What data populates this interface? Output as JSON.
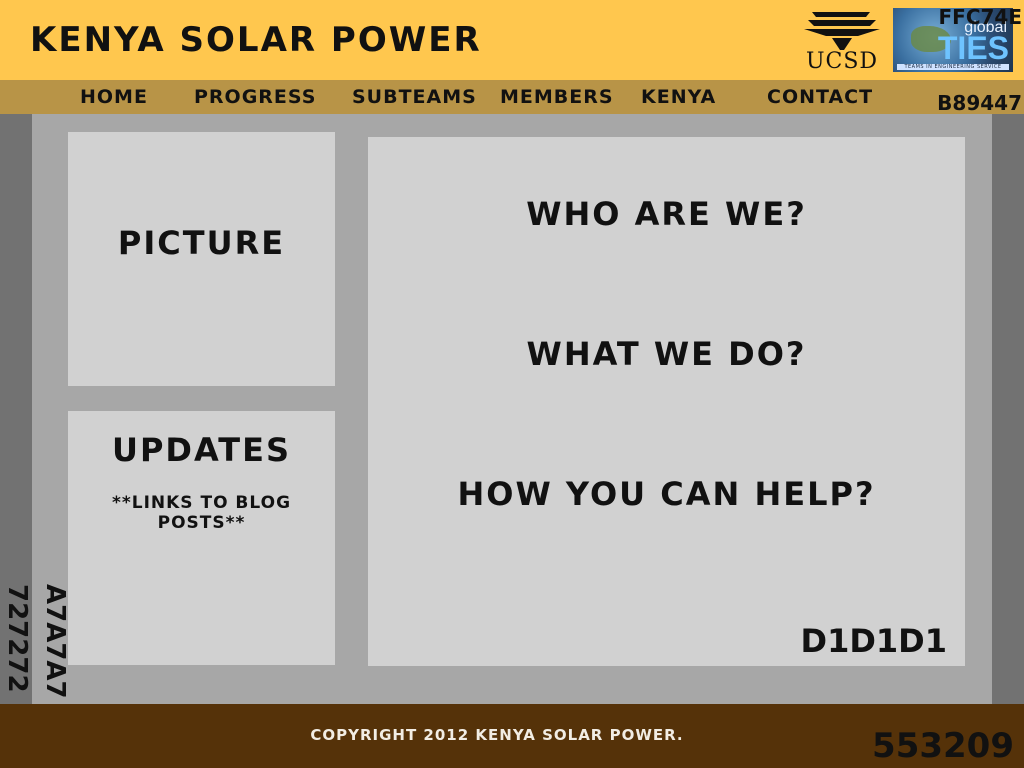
{
  "header": {
    "title": "Kenya Solar Power",
    "color_tag": "FFC74E",
    "background": "#FFC74E",
    "ucsd_logo_text": "UCSD",
    "ties_logo": {
      "global": "global",
      "big": "TIES",
      "tagline": "TEAMS IN ENGINEERING SERVICE"
    }
  },
  "nav": {
    "background": "#B89447",
    "color_tag": "B89447",
    "items": [
      {
        "label": "Home"
      },
      {
        "label": "Progress"
      },
      {
        "label": "Subteams"
      },
      {
        "label": "Members"
      },
      {
        "label": "Kenya"
      },
      {
        "label": "Contact"
      }
    ]
  },
  "side": {
    "outer_color_tag": "727272",
    "inner_color_tag": "A7A7A7",
    "outer_background": "#727272",
    "inner_background": "#A7A7A7"
  },
  "picture_panel": {
    "heading": "Picture"
  },
  "updates_panel": {
    "heading": "Updates",
    "subtext": "**Links to blog posts**"
  },
  "main_panel": {
    "background": "#D1D1D1",
    "color_tag": "D1D1D1",
    "questions": [
      "Who are we?",
      "What we do?",
      "How you can help?"
    ]
  },
  "footer": {
    "background": "#553209",
    "copyright": "Copyright 2012 Kenya Solar Power.",
    "color_tag": "553209"
  }
}
